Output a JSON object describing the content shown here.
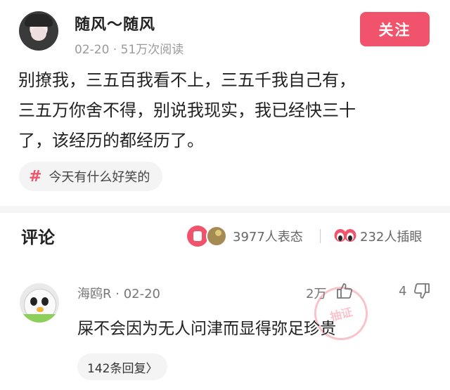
{
  "post": {
    "author": "随风～随风",
    "date": "02-20",
    "views": "51万次阅读",
    "follow_label": "关注",
    "body_lines": [
      "别撩我，三五百我看不上，三五千我自己有，",
      "三五万你舍不得，别说我现实，我已经快三十",
      "了，该经历的都经历了。"
    ],
    "topic_icon": "#",
    "topic": "今天有什么好笑的"
  },
  "comments_header": {
    "title": "评论",
    "reactions": "3977人表态",
    "inserts": "232人插眼"
  },
  "comment": {
    "user": "海鸥R",
    "date": "02-20",
    "likes": "2万",
    "replies_count": "4",
    "text": "屎不会因为无人问津而显得弥足珍贵",
    "reply_link": "142条回复〉"
  },
  "colors": {
    "accent": "#f0536b",
    "muted": "#9a9a9a"
  },
  "icons": {
    "topic": "hashtag-icon",
    "like": "thumbs-up-icon",
    "dislike": "thumbs-down-icon",
    "reaction_badge": "reaction-icon",
    "insert_eye": "eyes-icon"
  }
}
